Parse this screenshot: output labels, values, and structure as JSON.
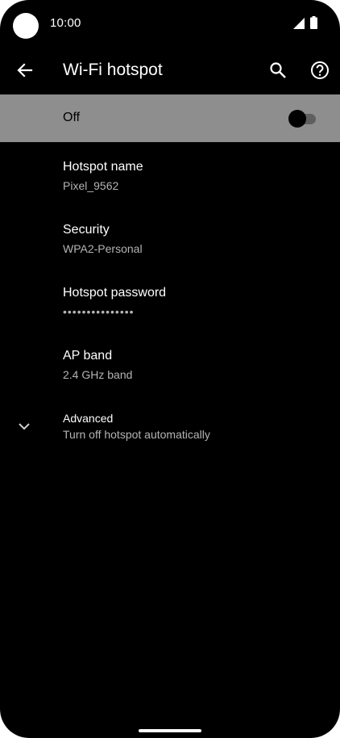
{
  "status_bar": {
    "time": "10:00",
    "icons": [
      "camera-cutout",
      "signal-icon",
      "battery-icon"
    ]
  },
  "app_bar": {
    "title": "Wi-Fi hotspot",
    "icons": [
      "back-arrow-icon",
      "search-icon",
      "help-icon"
    ]
  },
  "master_switch": {
    "label": "Off",
    "state": "off"
  },
  "preferences": [
    {
      "title": "Hotspot name",
      "summary": "Pixel_9562"
    },
    {
      "title": "Security",
      "summary": "WPA2-Personal"
    },
    {
      "title": "Hotspot password",
      "summary": "•••••••••••••••"
    },
    {
      "title": "AP band",
      "summary": "2.4 GHz band"
    }
  ],
  "advanced": {
    "title": "Advanced",
    "summary": "Turn off hotspot automatically",
    "icon": "chevron-down-icon"
  },
  "colors": {
    "background": "#000000",
    "master_bar": "#8e8e8e",
    "text_primary": "#ffffff",
    "text_secondary": "#b4b4b4"
  }
}
